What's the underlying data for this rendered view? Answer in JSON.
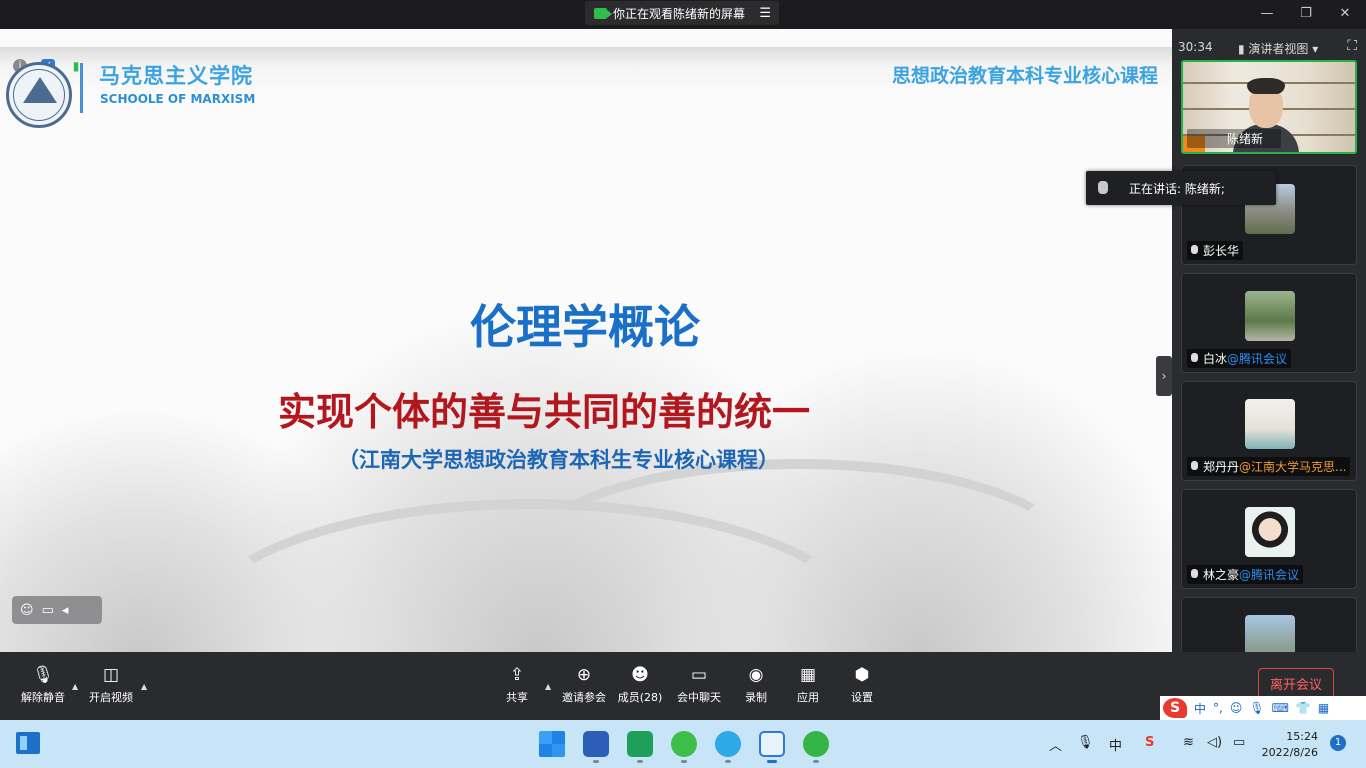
{
  "window": {
    "banner": "你正在观看陈绪新的屏幕",
    "banner_menu_icon": "menu-icon"
  },
  "slide": {
    "school_cn": "马克思主义学院",
    "school_en": "SCHOOLE  OF MARXISM",
    "header": "思想政治教育本科专业核心课程",
    "title": "伦理学概论",
    "subtitle": "实现个体的善与共同的善的统一",
    "note": "（江南大学思想政治教育本科生专业核心课程）"
  },
  "sidebar": {
    "timer": "30:34",
    "view_label": "演讲者视图",
    "presenter": {
      "name": "陈绪新"
    },
    "speaking_tip": "正在讲话: 陈绪新;",
    "participants": [
      {
        "name": "彭长华",
        "org": ""
      },
      {
        "name": "白冰",
        "org": "@腾讯会议"
      },
      {
        "name": "郑丹丹",
        "org": "@江南大学马克思..."
      },
      {
        "name": "林之豪",
        "org": "@腾讯会议"
      }
    ]
  },
  "toolbar": {
    "unmute": "解除静音",
    "start_video": "开启视频",
    "share": "共享",
    "invite": "邀请参会",
    "members": "成员(28)",
    "chat": "会中聊天",
    "record": "录制",
    "apps": "应用",
    "settings": "设置",
    "leave": "离开会议"
  },
  "ime": {
    "lang": "中"
  },
  "taskbar": {
    "time": "15:24",
    "date": "2022/8/26",
    "notifications": "1",
    "ime_lang": "中"
  },
  "colors": {
    "accent_blue": "#1a70c7",
    "subtitle_red": "#b3161c",
    "leave_red": "#e04545",
    "active_green": "#27b14a"
  }
}
